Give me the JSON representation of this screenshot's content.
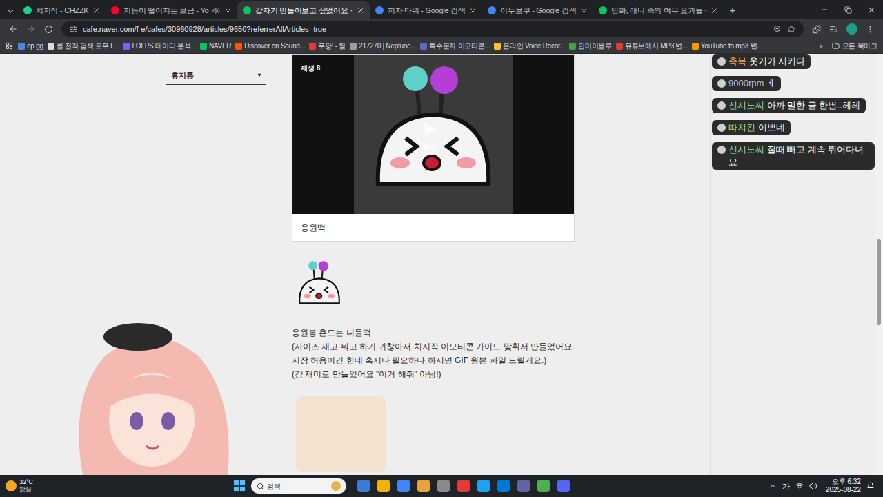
{
  "browser": {
    "tabs": [
      {
        "label": "치지직 - CHZZK",
        "selected": false,
        "audio": false,
        "color": "#1ed28a"
      },
      {
        "label": "지능이 떨어지는 브금 - Yo",
        "selected": false,
        "audio": true,
        "color": "#ff0033"
      },
      {
        "label": "갑자기 만들어보고 싶었어요 ·",
        "selected": true,
        "audio": false,
        "color": "#03c75a"
      },
      {
        "label": "피자 타워 - Google 검색",
        "selected": false,
        "audio": false,
        "color": "#4285f4"
      },
      {
        "label": "이누보쿠 - Google 검색",
        "selected": false,
        "audio": false,
        "color": "#4285f4"
      },
      {
        "label": "만화, 애니 속의 여우 요괴들 ·",
        "selected": false,
        "audio": false,
        "color": "#03c75a"
      }
    ],
    "new_tab": "+",
    "url": "cafe.naver.com/f-e/cafes/30960928/articles/9650?referrerAllArticles=true",
    "bookmarks": [
      {
        "label": "op.gg",
        "color": "#5383e8"
      },
      {
        "label": "롤 전적 검색 포우 F...",
        "color": "#dddddd"
      },
      {
        "label": "LOLPS 데이터 분석...",
        "color": "#7b61ff"
      },
      {
        "label": "NAVER",
        "color": "#03c75a"
      },
      {
        "label": "Discover on Sound...",
        "color": "#ff5500"
      },
      {
        "label": "쿠팡! - 쩜",
        "color": "#e53935"
      },
      {
        "label": "217270 | Neptune...",
        "color": "#9e9e9e"
      },
      {
        "label": "특수문자 이모티콘...",
        "color": "#5c6bc0"
      },
      {
        "label": "온라인 Voice Recor...",
        "color": "#fbc02d"
      },
      {
        "label": "인마이블루",
        "color": "#43a047"
      },
      {
        "label": "유튜브에서 MP3 변...",
        "color": "#e53935"
      },
      {
        "label": "YouTube to mp3 변...",
        "color": "#ff9800"
      }
    ],
    "bookmarks_more": "»",
    "all_bookmarks": "모든 북마크"
  },
  "sidebar": {
    "item": "휴지통",
    "arrow": "▾"
  },
  "article": {
    "video": {
      "badge": "재생 8",
      "time": "00:10",
      "caption": "응원떡"
    },
    "paragraphs": [
      "응원봉 흔드는 니들떡",
      "(사이즈 재고 뭐고 하기 귀찮아서 치지직 이모티콘 가이드 맞춰서 만들었어요.",
      "저장 허용이긴 한데 혹시나 필요하다 하시면 GIF 원본 파일 드릴게요.)",
      "(걍 재미로 만들었어요 \"이거 해줘\" 아님!)"
    ]
  },
  "chat": [
    {
      "name": "축복",
      "message": "웃기가 시키다",
      "color": "#f5a25d"
    },
    {
      "name": "9000rpm",
      "message": "ㅔ",
      "color": "#b8c7d9"
    },
    {
      "name": "신시노씨",
      "message": "아까 말한 글 한번..헤헤",
      "color": "#8fe3b0"
    },
    {
      "name": "따치킨",
      "message": "이쁘네",
      "color": "#a6e88a"
    },
    {
      "name": "신시노씨",
      "message": "잘때 빼고 계속 뛰어다녀요",
      "color": "#8fe3b0"
    }
  ],
  "taskbar": {
    "temp": "32°C",
    "weather": "맑음",
    "search": "검색",
    "ime": "가",
    "time": "오후 6:32",
    "date": "2025-08-22"
  }
}
